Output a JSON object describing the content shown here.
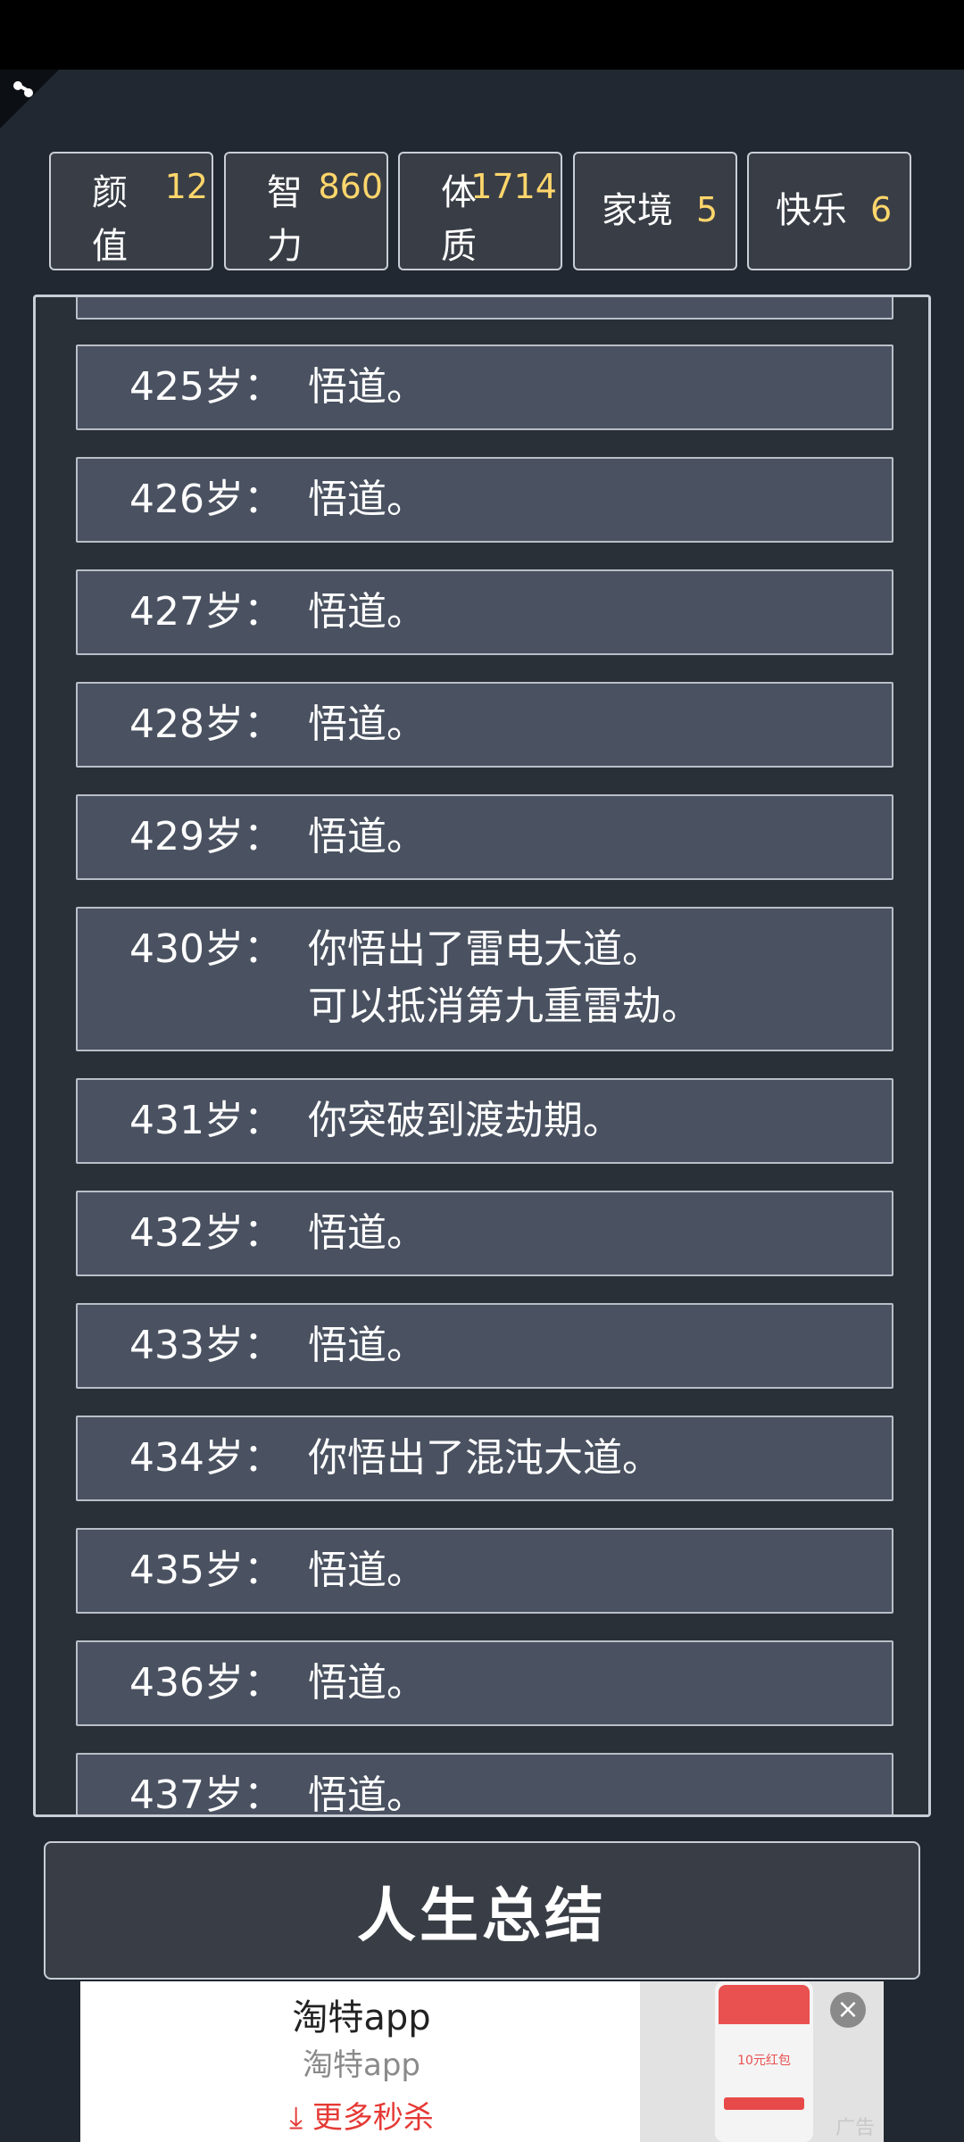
{
  "stats": [
    {
      "label": "颜值",
      "value": "12"
    },
    {
      "label": "智力",
      "value": "860"
    },
    {
      "label": "体质",
      "value": "1714"
    },
    {
      "label": "家境",
      "value": "5"
    },
    {
      "label": "快乐",
      "value": "6"
    }
  ],
  "log": [
    {
      "age": "425岁：",
      "text": "悟道。"
    },
    {
      "age": "426岁：",
      "text": "悟道。"
    },
    {
      "age": "427岁：",
      "text": "悟道。"
    },
    {
      "age": "428岁：",
      "text": "悟道。"
    },
    {
      "age": "429岁：",
      "text": "悟道。"
    },
    {
      "age": "430岁：",
      "text": "你悟出了雷电大道。\n可以抵消第九重雷劫。"
    },
    {
      "age": "431岁：",
      "text": "你突破到渡劫期。"
    },
    {
      "age": "432岁：",
      "text": "悟道。"
    },
    {
      "age": "433岁：",
      "text": "悟道。"
    },
    {
      "age": "434岁：",
      "text": "你悟出了混沌大道。"
    },
    {
      "age": "435岁：",
      "text": "悟道。"
    },
    {
      "age": "436岁：",
      "text": "悟道。"
    },
    {
      "age": "437岁：",
      "text": "悟道。"
    }
  ],
  "summary_button": "人生总结",
  "ad": {
    "title": "淘特app",
    "subtitle": "淘特app",
    "cta": "更多秒杀",
    "tag": "广告",
    "coupon_text": "10元红包"
  },
  "colors": {
    "background": "#222831",
    "accent_value": "#ffd66b",
    "row_fill": "#4a5261",
    "ad_cta": "#e53935"
  }
}
